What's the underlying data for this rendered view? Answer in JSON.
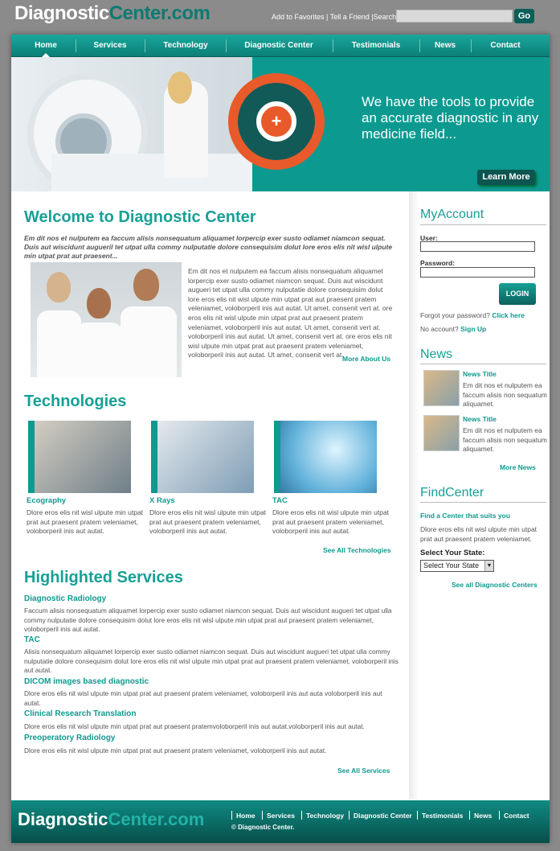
{
  "header": {
    "logo_part1": "Diagnostic",
    "logo_part2": "Center.com",
    "toplinks": "Add to Favorites | Tell a Friend |Search:",
    "search_placeholder": "",
    "go_label": "Go"
  },
  "nav": {
    "items": [
      {
        "label": "Home"
      },
      {
        "label": "Services"
      },
      {
        "label": "Technology"
      },
      {
        "label": "Diagnostic Center"
      },
      {
        "label": "Testimonials"
      },
      {
        "label": "News"
      },
      {
        "label": "Contact"
      }
    ]
  },
  "hero": {
    "headline": "We have the tools to provide an accurate diagnostic in any medicine field...",
    "button": "Learn More"
  },
  "welcome": {
    "title": "Welcome to Diagnostic Center",
    "lead": "Em dit nos et nulputem ea faccum alisis nonsequatum aliquamet lorpercip exer susto odiamet niamcon sequat. Duis aut wiscidunt augueril tet utpat ulla commy nulputatie dolore consequisim dolut lore eros elis nit wisl ulpute min utpat prat aut praesent...",
    "body": "Em dit nos et nulputem ea faccum alisis nonsequatum aliquamet lorpercip exer susto odiamet niamcon sequat. Duis aut wiscidunt augueri tet utpat ulla commy nulputatie dolore consequisim dolut lore eros elis nit wisl ulpute min utpat prat aut praesent pratem veleniamet, voloborperil inis aut autat. Ut amet, consenit vert at. ore eros elis nit wisl ulpute min utpat prat aut praesent pratem veleniamet, voloborperil inis aut autat. Ut amet, consenit vert at. voloborperil inis aut autat. Ut amet, consenit vert at. ore eros elis nit wisl ulpute min utpat prat aut praesent pratem veleniamet, voloborperil inis aut autat. Ut amet, consenit vert at.",
    "more_link": "More About Us"
  },
  "technologies": {
    "title": "Technologies",
    "items": [
      {
        "title": "Ecography",
        "text": "Dlore eros elis nit wisl ulpute min utpat prat aut praesent pratem veleniamet, voloborperil inis aut autat."
      },
      {
        "title": "X Rays",
        "text": "Dlore eros elis nit wisl ulpute min utpat prat aut praesent pratem veleniamet, voloborperil inis aut autat."
      },
      {
        "title": "TAC",
        "text": "Dlore eros elis nit wisl ulpute min utpat prat aut praesent pratem veleniamet, voloborperil inis aut autat."
      }
    ],
    "more_link": "See All Technologies"
  },
  "services": {
    "title": "Highlighted Services",
    "items": [
      {
        "title": "Diagnostic Radiology",
        "text": "Faccum alisis nonsequatum aliquamet lorpercip exer susto odiamet niamcon sequat. Duis aut wiscidunt augueri tet utpat ulla commy nulputatie dolore consequisim dolut lore eros elis nit wisl ulpute min utpat prat aut praesent pratem veleniamet, voloborperil inis aut autat."
      },
      {
        "title": "TAC",
        "text": "Alisis nonsequatum aliquamet lorpercip exer susto odiamet niamcon sequat. Duis aut wiscidunt augueri tet utpat ulla commy nulputatie dolore consequisim dolut lore eros elis nit wisl ulpute min utpat prat aut praesent pratem veleniamet, voloborperil inis aut autat."
      },
      {
        "title": "DICOM images based diagnostic",
        "text": "Dlore eros elis nit wisl ulpute min utpat prat aut praesent pratem veleniamet, voloborperil inis aut auta voloborperil inis aut autat."
      },
      {
        "title": "Clinical Research Translation",
        "text": "Dlore eros elis nit wisl ulpute min utpat prat aut praesent pratemvoloborperil inis aut autat.voloborperil inis aut autat."
      },
      {
        "title": "Preoperatory Radiology",
        "text": "Dlore eros elis nit wisl ulpute min utpat prat aut praesent pratem veleniamet, voloborperil inis aut autat."
      }
    ],
    "more_link": "See All Services"
  },
  "myaccount": {
    "title": "MyAccount",
    "user_label": "User:",
    "password_label": "Password:",
    "login_label": "LOGIN",
    "forgot_text": "Forgot your password?",
    "forgot_link": "Click here",
    "noaccount_text": "No account?",
    "signup_link": "Sign Up"
  },
  "news": {
    "title": "News",
    "items": [
      {
        "title": "News Title",
        "text": "Em dit nos et nulputem ea faccum alisis non sequatum aliquamet."
      },
      {
        "title": "News Title",
        "text": "Em dit nos et nulputem ea faccum alisis non sequatum aliquamet."
      }
    ],
    "more_link": "More News"
  },
  "findcenter": {
    "title": "FindCenter",
    "subtitle": "Find a Center that suits you",
    "text": "Dlore eros elis nit wisl ulpute min utpat prat aut praesent pratem veleniamet.",
    "state_label": "Select Your State:",
    "state_value": "Select Your State",
    "more_link": "See all Diagnostic Centers"
  },
  "footer": {
    "logo_part1": "Diagnostic",
    "logo_part2": "Center.com",
    "nav": [
      "Home",
      "Services",
      "Technology",
      "Diagnostic Center",
      "Testimonials",
      "News",
      "Contact"
    ],
    "copyright": "© Diagnostic Center."
  },
  "colors": {
    "accent": "#17a096",
    "dark_teal": "#0b625c",
    "background": "#8a8a8a"
  }
}
